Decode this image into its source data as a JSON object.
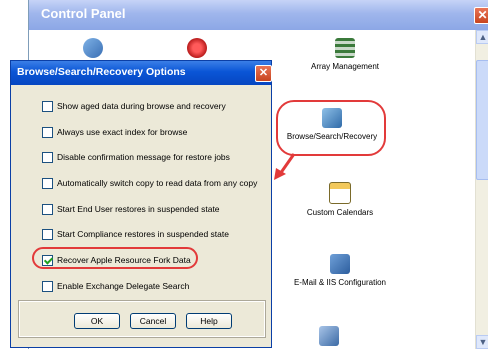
{
  "control_panel": {
    "title": "Control Panel",
    "close_glyph": "✕",
    "items": [
      {
        "label": "",
        "icon": "clock-gear-icon"
      },
      {
        "label": "",
        "icon": "alert-icon"
      },
      {
        "label": "Array Management",
        "icon": "array-icon"
      },
      {
        "label": "Browse/Search/Recovery",
        "icon": "browse-icon"
      },
      {
        "label": "Custom Calendars",
        "icon": "calendar-icon"
      },
      {
        "label": "E-Mail & IIS Configuration",
        "icon": "email-icon"
      },
      {
        "label": "",
        "icon": "computer-icon"
      }
    ],
    "scroll_up": "▲",
    "scroll_down": "▼"
  },
  "dialog": {
    "title": "Browse/Search/Recovery Options",
    "close_glyph": "✕",
    "options": [
      {
        "label": "Show aged data during browse and recovery",
        "checked": false
      },
      {
        "label": "Always use exact index for browse",
        "checked": false
      },
      {
        "label": "Disable confirmation message for restore jobs",
        "checked": false
      },
      {
        "label": "Automatically switch copy to read data from any copy",
        "checked": false
      },
      {
        "label": "Start End User restores in suspended state",
        "checked": false
      },
      {
        "label": "Start Compliance restores in suspended state",
        "checked": false
      },
      {
        "label": "Recover Apple Resource Fork Data",
        "checked": true
      },
      {
        "label": "Enable Exchange Delegate Search",
        "checked": false
      }
    ],
    "buttons": {
      "ok": "OK",
      "cancel": "Cancel",
      "help": "Help"
    }
  },
  "colors": {
    "highlight": "#e23a3a",
    "dialog_title": "#0a55d6",
    "cp_title": "#9fb6ec"
  }
}
